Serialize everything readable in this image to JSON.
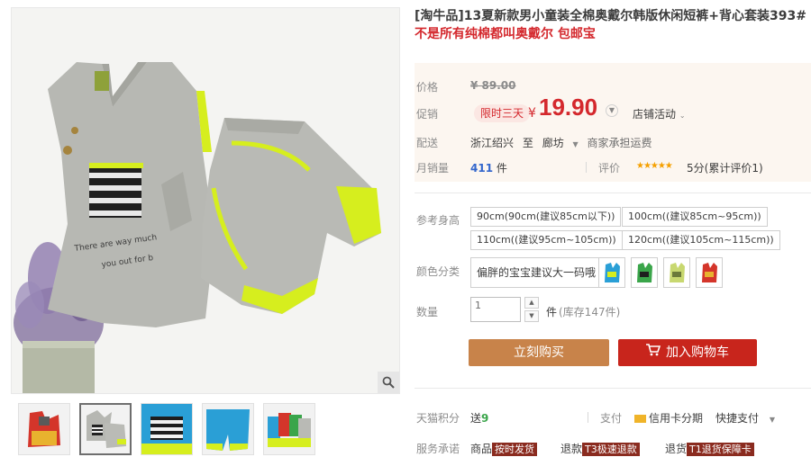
{
  "product": {
    "title": "[淘牛品]13夏新款男小童装全棉奥戴尔韩版休闲短裤+背心套装393#",
    "subtitle": "不是所有纯棉都叫奥戴尔 包邮宝"
  },
  "price": {
    "label": "价格",
    "original": "¥ 89.00",
    "promo_label": "促销",
    "promo_tag": "限时三天",
    "currency": "¥",
    "current": "19.90",
    "shop_promo": "店铺活动"
  },
  "shipping": {
    "label": "配送",
    "from": "浙江绍兴",
    "to_word": "至",
    "dest": "廊坊",
    "note": "商家承担运费"
  },
  "sales": {
    "label": "月销量",
    "count": "411",
    "unit": "件",
    "review_label": "评价",
    "stars": "★★★★★",
    "score": "5分(累计评价1)"
  },
  "size": {
    "label": "参考身高",
    "options": [
      "90cm(90cm(建议85cm以下))",
      "100cm((建议85cm~95cm))",
      "110cm((建议95cm~105cm))",
      "120cm((建议105cm~115cm))"
    ]
  },
  "color": {
    "label": "颜色分类",
    "text_option": "偏胖的宝宝建议大一码哦",
    "swatches": [
      "blue",
      "green",
      "light-green",
      "red"
    ]
  },
  "quantity": {
    "label": "数量",
    "value": "1",
    "unit": "件",
    "stock": "(库存147件)"
  },
  "actions": {
    "buy": "立刻购买",
    "cart": "加入购物车"
  },
  "payment": {
    "label": "天猫积分",
    "points_prefix": "送",
    "points": "9",
    "pay_label": "支付",
    "credit": "信用卡分期",
    "quick": "快捷支付"
  },
  "service": {
    "label": "服务承诺",
    "item1_prefix": "商品",
    "item1_tag": "按时发货",
    "item2_prefix": "退款",
    "item2_tag": "T3极速退款",
    "item3_prefix": "退货",
    "item3_tag": "T1退货保障卡"
  },
  "colors": {
    "accent_red": "#d4282d",
    "buy_orange": "#c8834a",
    "cart_red": "#c8251c",
    "price_bg": "#fcf6f0",
    "link_blue": "#3366cc"
  }
}
